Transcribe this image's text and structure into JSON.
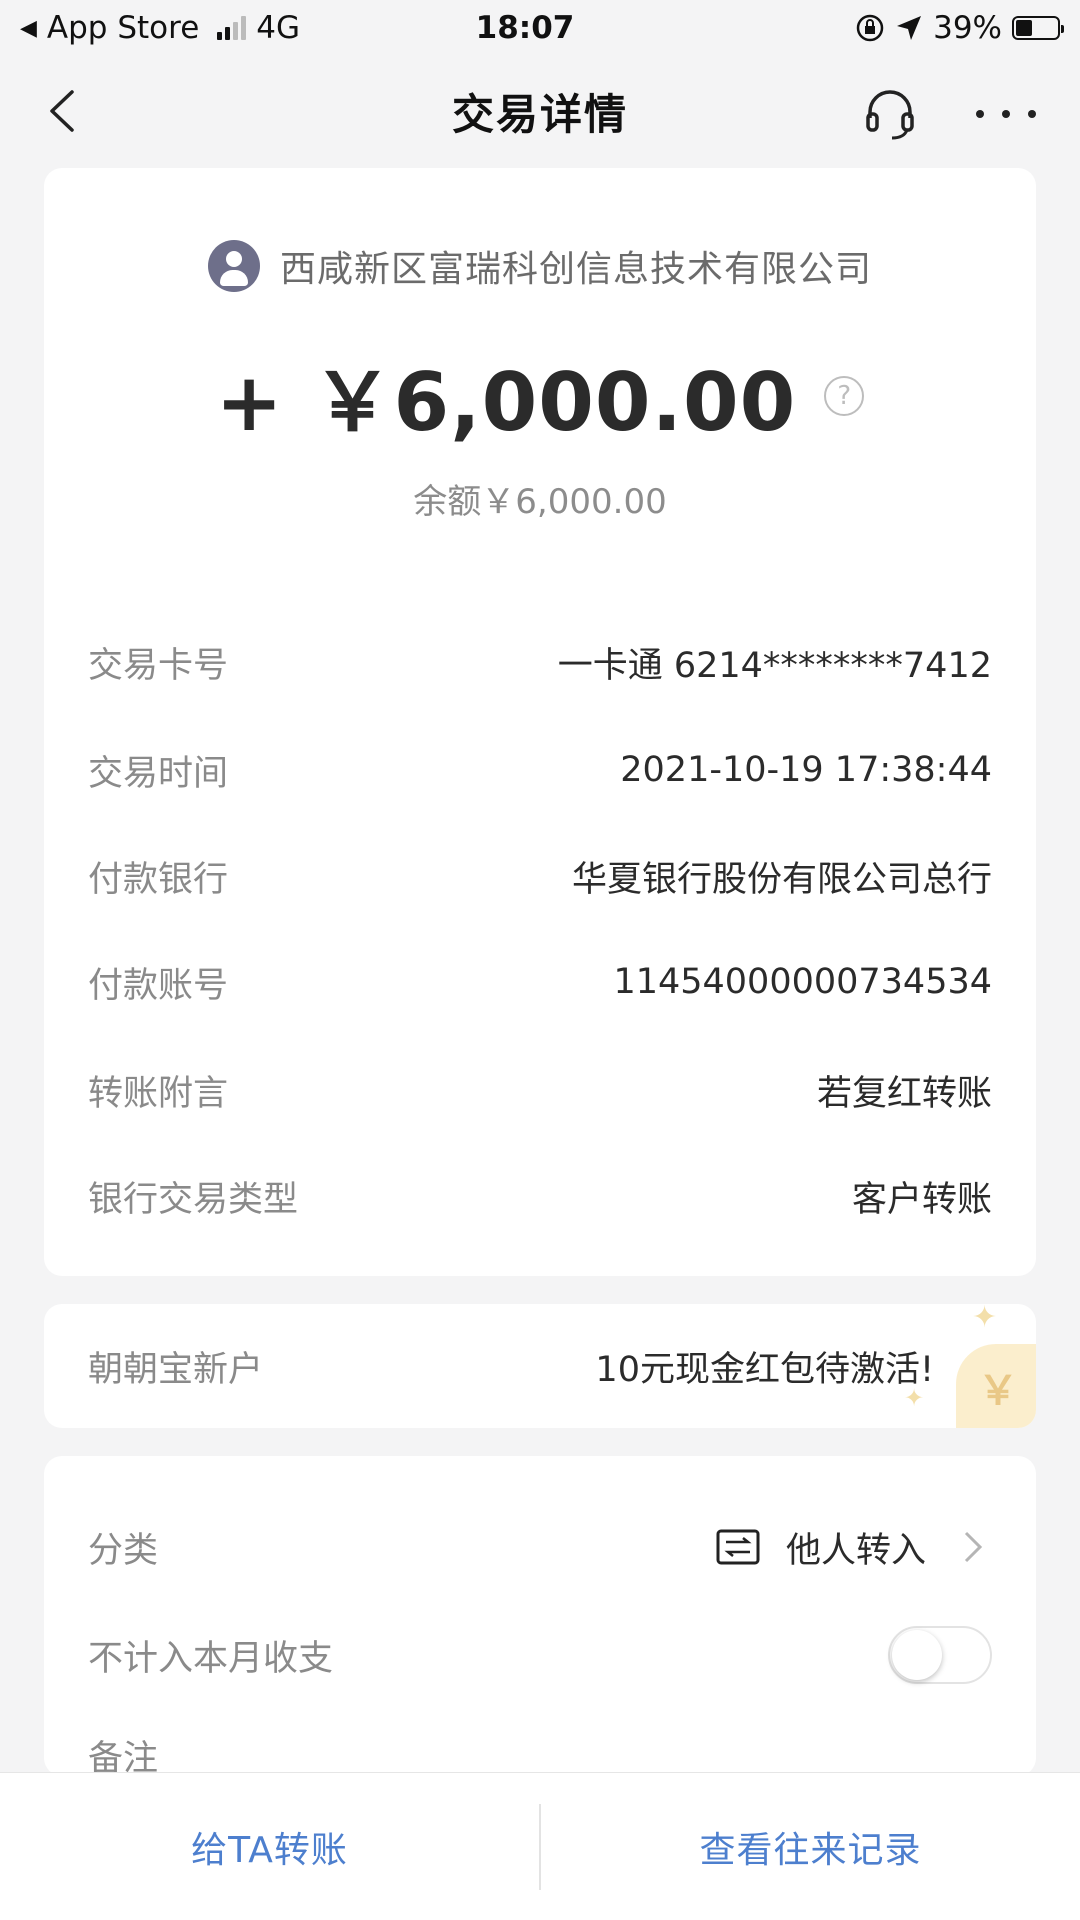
{
  "status_bar": {
    "back_app": "App Store",
    "network": "4G",
    "time": "18:07",
    "battery": "39%"
  },
  "nav": {
    "title": "交易详情"
  },
  "transaction": {
    "payer": "西咸新区富瑞科创信息技术有限公司",
    "amount": "+ ￥6,000.00",
    "balance": "余额￥6,000.00",
    "help_glyph": "?"
  },
  "details": [
    {
      "label": "交易卡号",
      "value": "一卡通 6214********7412"
    },
    {
      "label": "交易时间",
      "value": "2021-10-19 17:38:44"
    },
    {
      "label": "付款银行",
      "value": "华夏银行股份有限公司总行"
    },
    {
      "label": "付款账号",
      "value": "11454000000734534"
    },
    {
      "label": "转账附言",
      "value": "若复红转账"
    },
    {
      "label": "银行交易类型",
      "value": "客户转账"
    }
  ],
  "promo": {
    "label": "朝朝宝新户",
    "value": "10元现金红包待激活!",
    "deco_glyph": "￥"
  },
  "category": {
    "label": "分类",
    "value": "他人转入",
    "exclude_label": "不计入本月收支",
    "exclude_toggle": false,
    "note_label": "备注"
  },
  "bottom": {
    "transfer_label": "给TA转账",
    "history_label": "查看往来记录"
  },
  "colors": {
    "accent_link": "#4d7fce",
    "background": "#f4f4f5",
    "card": "#ffffff"
  }
}
